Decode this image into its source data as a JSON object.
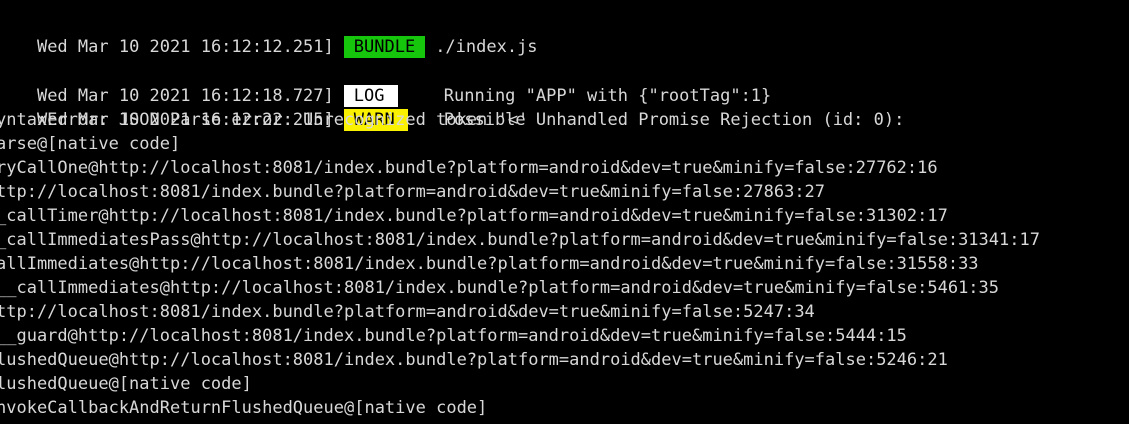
{
  "colors": {
    "background": "#000000",
    "text": "#d8d8d8",
    "bundle_badge": "#16c60c",
    "log_badge": "#ffffff",
    "warn_badge": "#f9f100"
  },
  "log": {
    "bundle": {
      "timestamp": "Wed Mar 10 2021 16:12:12.251]",
      "badge": "BUNDLE",
      "message": "./index.js"
    },
    "log": {
      "timestamp": "Wed Mar 10 2021 16:12:18.727]",
      "badge": "LOG",
      "message": "Running \"APP\" with {\"rootTag\":1}"
    },
    "warn": {
      "timestamp": "Wed Mar 10 2021 16:12:22.215]",
      "badge": "WARN",
      "message": "Possible Unhandled Promise Rejection (id: 0):"
    },
    "stack": [
      "yntaxError: JSON Parse error: Unrecognized token '<'",
      "arse@[native code]",
      "ryCallOne@http://localhost:8081/index.bundle?platform=android&dev=true&minify=false:27762:16",
      "ttp://localhost:8081/index.bundle?platform=android&dev=true&minify=false:27863:27",
      "_callTimer@http://localhost:8081/index.bundle?platform=android&dev=true&minify=false:31302:17",
      "_callImmediatesPass@http://localhost:8081/index.bundle?platform=android&dev=true&minify=false:31341:17",
      "allImmediates@http://localhost:8081/index.bundle?platform=android&dev=true&minify=false:31558:33",
      "__callImmediates@http://localhost:8081/index.bundle?platform=android&dev=true&minify=false:5461:35",
      "ttp://localhost:8081/index.bundle?platform=android&dev=true&minify=false:5247:34",
      "__guard@http://localhost:8081/index.bundle?platform=android&dev=true&minify=false:5444:15",
      "lushedQueue@http://localhost:8081/index.bundle?platform=android&dev=true&minify=false:5246:21",
      "lushedQueue@[native code]",
      "nvokeCallbackAndReturnFlushedQueue@[native code]"
    ]
  }
}
